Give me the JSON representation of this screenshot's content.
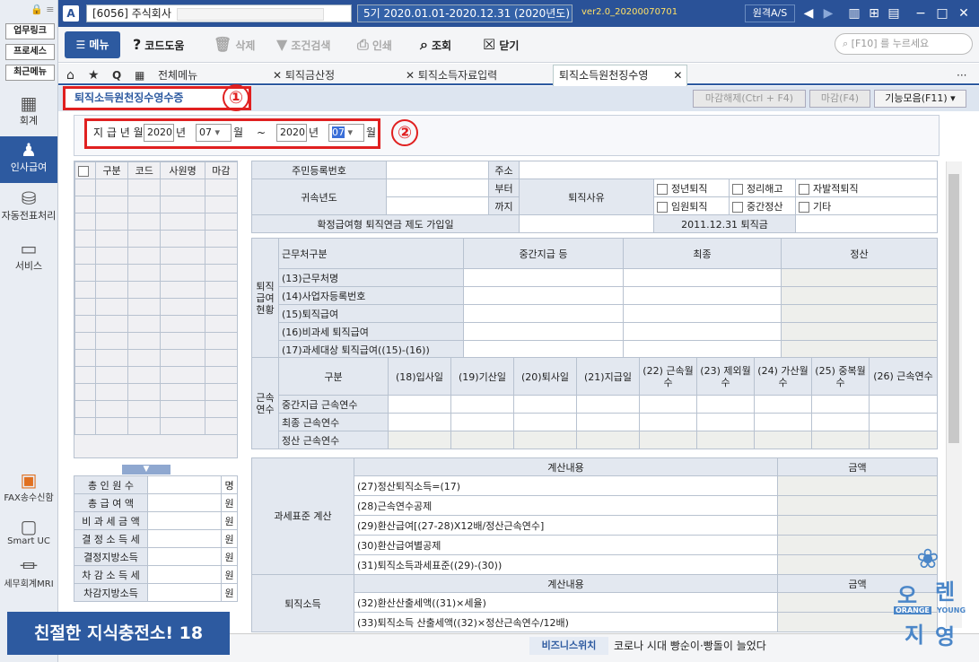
{
  "sidebar": {
    "links": [
      "업무링크",
      "프로세스",
      "최근메뉴"
    ],
    "items": [
      {
        "label": "회계",
        "icon": "calculator-icon"
      },
      {
        "label": "인사급여",
        "icon": "user-icon"
      },
      {
        "label": "자동전표처리",
        "icon": "database-icon"
      },
      {
        "label": "서비스",
        "icon": "monitor-icon"
      }
    ],
    "bottom": [
      {
        "label": "FAX송수신함",
        "icon": "fax-icon"
      },
      {
        "label": "Smart UC",
        "icon": "uc-icon"
      },
      {
        "label": "세무회계MRI",
        "icon": "chart-icon"
      }
    ]
  },
  "titlebar": {
    "company": "[6056] 주식회사",
    "period": "5기  2020.01.01-2020.12.31  (2020년도)",
    "version": "ver2.0_20200070701",
    "remote_btn": "원격A/S"
  },
  "toolbar": {
    "menu": "메뉴",
    "code": "코드도움",
    "delete": "삭제",
    "search_cond": "조건검색",
    "print": "인쇄",
    "view": "조회",
    "close": "닫기",
    "search_placeholder": "[F10] 를 누르세요"
  },
  "tabs": [
    "전체메뉴",
    "퇴직금산정",
    "퇴직소득자료입력",
    "퇴직소득원천징수영"
  ],
  "page": {
    "title": "퇴직소득원천징수영수증",
    "btn_unclose": "마감해제(Ctrl + F4)",
    "btn_close": "마감(F4)",
    "btn_funcs": "기능모음(F11)",
    "circle1": "①",
    "circle2": "②"
  },
  "filter": {
    "label": "지 급 년 월",
    "year1": "2020",
    "year_unit": "년",
    "month1": "07",
    "month_unit": "월",
    "tilde": "~",
    "year2": "2020",
    "month2": "07"
  },
  "left_grid": {
    "headers": [
      "구분",
      "코드",
      "사원명",
      "마감"
    ]
  },
  "summary": [
    [
      "총 인 원 수",
      "명"
    ],
    [
      "총 급 여 액",
      "원"
    ],
    [
      "비 과 세 금 액",
      "원"
    ],
    [
      "결 정 소 득 세",
      "원"
    ],
    [
      "결정지방소득",
      "원"
    ],
    [
      "차 감 소 득 세",
      "원"
    ],
    [
      "차감지방소득",
      "원"
    ]
  ],
  "info": {
    "jumin": "주민등록번호",
    "address": "주소",
    "gwisok": "귀속년도",
    "from": "부터",
    "to": "까지",
    "reason": "퇴직사유",
    "r1": "정년퇴직",
    "r2": "정리해고",
    "r3": "자발적퇴직",
    "r4": "임원퇴직",
    "r5": "중간정산",
    "r6": "기타",
    "dc": "확정급여형 퇴직연금 제도 가입일",
    "dc_date": "2011.12.31 퇴직금"
  },
  "retire": {
    "side": "퇴직 급여 현황",
    "col0": "근무처구분",
    "cols": [
      "중간지급 등",
      "최종",
      "정산"
    ],
    "rows": [
      "(13)근무처명",
      "(14)사업자등록번호",
      "(15)퇴직급여",
      "(16)비과세 퇴직급여",
      "(17)과세대상 퇴직급여((15)-(16))"
    ]
  },
  "tenure": {
    "side": "근속 연수",
    "col0": "구분",
    "cols": [
      "(18)입사일",
      "(19)기산일",
      "(20)퇴사일",
      "(21)지급일",
      "(22) 근속월수",
      "(23) 제외월수",
      "(24) 가산월수",
      "(25) 중복월수",
      "(26) 근속연수"
    ],
    "rows": [
      "중간지급 근속연수",
      "최종 근속연수",
      "정산 근속연수"
    ]
  },
  "tax": {
    "side": "과세표준 계산",
    "head1": "계산내용",
    "head2": "금액",
    "rows": [
      "(27)정산퇴직소득=(17)",
      "(28)근속연수공제",
      "(29)환산급여[(27-28)X12배/정산근속연수]",
      "(30)환산급여별공제",
      "(31)퇴직소득과세표준((29)-(30))"
    ],
    "side2": "퇴직소득",
    "row2": "(32)환산산출세액((31)×세율)",
    "row3": "(33)퇴직소득 산출세액((32)×정산근속연수/12배)"
  },
  "status": {
    "banner": "친절한 지식충전소! 18",
    "biz": "비즈니스위치",
    "news": "코로나 시대 빵순이·빵돌이 늘었다"
  },
  "watermark": {
    "t1": "오",
    "t2": "렌",
    "t3": "지",
    "t4": "영",
    "brand1": "ORANGE",
    "brand2": "YOUNG"
  }
}
